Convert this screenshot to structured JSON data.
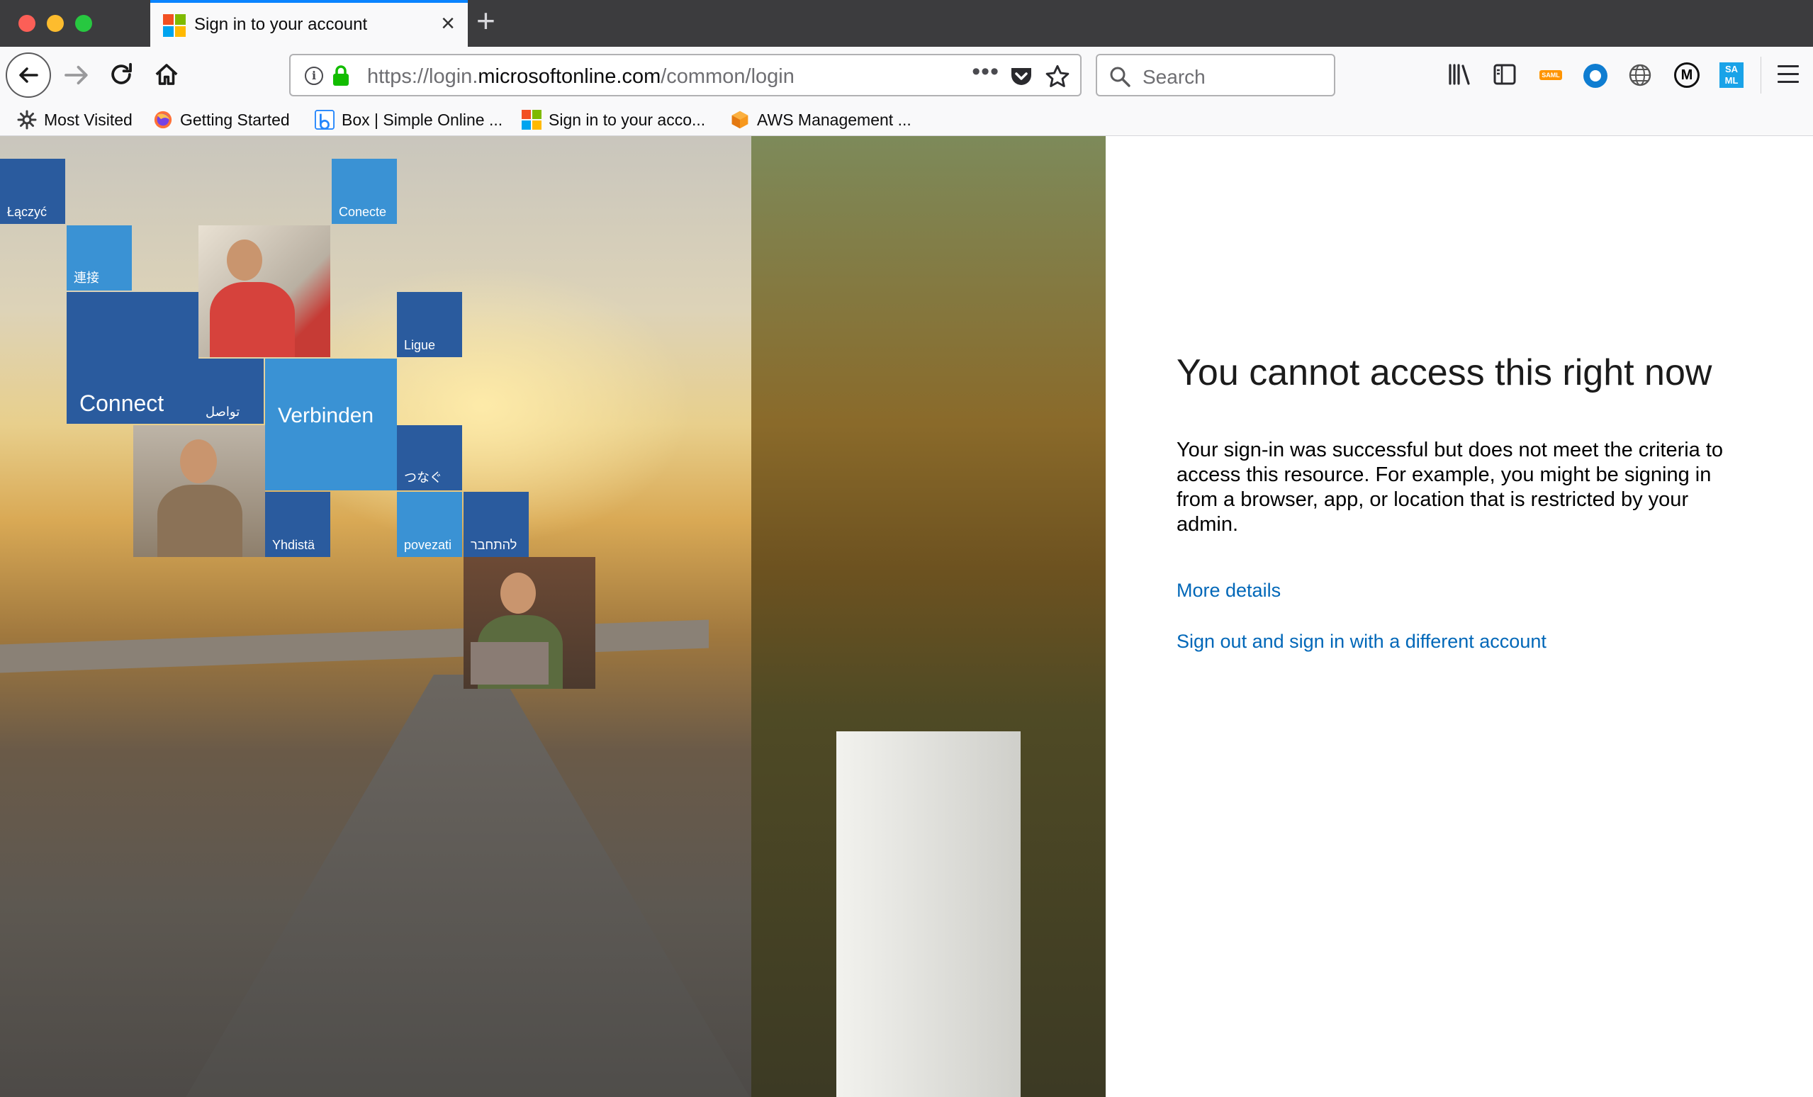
{
  "browser": {
    "tab": {
      "title": "Sign in to your account"
    },
    "url": {
      "scheme": "https://login.",
      "domain": "microsoftonline.com",
      "path": "/common/login"
    },
    "search": {
      "placeholder": "Search"
    },
    "bookmarks": [
      {
        "label": "Most Visited",
        "icon": "gear-icon"
      },
      {
        "label": "Getting Started",
        "icon": "firefox-icon"
      },
      {
        "label": "Box | Simple Online ...",
        "icon": "box-icon"
      },
      {
        "label": "Sign in to your acco...",
        "icon": "microsoft-icon"
      },
      {
        "label": "AWS Management ...",
        "icon": "aws-icon"
      }
    ],
    "extensions": {
      "saml_badge": "SAML",
      "m_badge": "M",
      "saml2_badge": "SA ML"
    }
  },
  "hero": {
    "tiles": [
      "Łączyć",
      "Conecte",
      "連接",
      "Ligue",
      "Connect",
      "تواصل",
      "Verbinden",
      "つなぐ",
      "Yhdistä",
      "povezati",
      "להתחבר"
    ]
  },
  "main": {
    "heading": "You cannot access this right now",
    "message": "Your sign-in was successful but does not meet the criteria to access this resource. For example, you might be signing in from a browser, app, or location that is restricted by your admin.",
    "more_details": "More details",
    "sign_out": "Sign out and sign in with a different account"
  },
  "colors": {
    "tile_dark": "#2a5b9e",
    "tile_light": "#3a92d4",
    "link": "#0067b8",
    "ms_red": "#f25022",
    "ms_green": "#7fba00",
    "ms_blue": "#00a4ef",
    "ms_yellow": "#ffb900"
  }
}
